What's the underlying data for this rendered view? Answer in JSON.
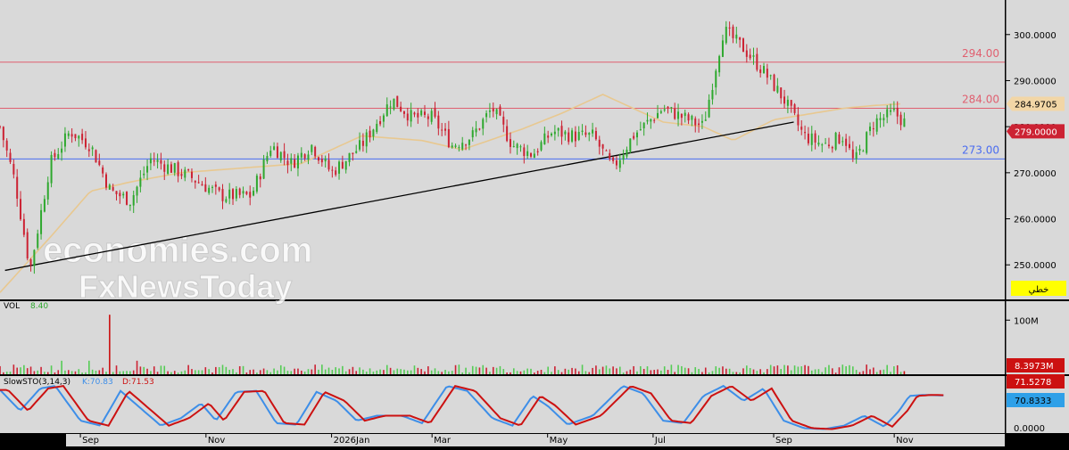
{
  "colors": {
    "background": "#d9d9d9",
    "frame": "#000000",
    "candle_up": "#2ea82e",
    "candle_down": "#cc2233",
    "resistance_line": "#e06070",
    "support_line": "#4a6cf0",
    "moving_average": "#e8c890",
    "trendline": "#000000",
    "stoch_k": "#3d8ee8",
    "stoch_d": "#cc1111",
    "volume": "#55cc55",
    "volume_last": "#cc1111"
  },
  "watermark": {
    "line1": "economies.com",
    "line2": "FxNewsToday"
  },
  "controls": {
    "line_tool_label": "خطي"
  },
  "chart_data": [
    {
      "type": "candlestick",
      "x_axis": {
        "tick_labels": [
          "Sep",
          "Nov",
          "2026Jan",
          "Mar",
          "May",
          "Jul",
          "Sep",
          "Nov"
        ]
      },
      "y_axis": {
        "min": 242.5,
        "max": 307.5,
        "tick_labels": [
          "250.0000",
          "260.0000",
          "270.0000",
          "280.0000",
          "290.0000",
          "300.0000"
        ],
        "ticks": [
          250,
          260,
          270,
          280,
          290,
          300
        ]
      },
      "horizontal_levels": [
        {
          "value": 294.0,
          "label": "294.00",
          "color": "resistance"
        },
        {
          "value": 284.0,
          "label": "284.00",
          "color": "resistance"
        },
        {
          "value": 273.0,
          "label": "273.00",
          "color": "support"
        }
      ],
      "price_tags": [
        {
          "label": "284.9705",
          "value": 284.97,
          "kind": "moving_average"
        },
        {
          "label": "279.0000",
          "value": 279.0,
          "kind": "last_price"
        }
      ],
      "trendline": {
        "from": {
          "x": 0.005,
          "y": 248.8
        },
        "to": {
          "x": 0.79,
          "y": 281.0
        }
      },
      "moving_average_anchors": [
        [
          0.0,
          244
        ],
        [
          0.05,
          256
        ],
        [
          0.09,
          266
        ],
        [
          0.13,
          268
        ],
        [
          0.18,
          270
        ],
        [
          0.24,
          271
        ],
        [
          0.3,
          272
        ],
        [
          0.36,
          278
        ],
        [
          0.42,
          277
        ],
        [
          0.46,
          275
        ],
        [
          0.5,
          278
        ],
        [
          0.52,
          279.5
        ],
        [
          0.56,
          283
        ],
        [
          0.6,
          287
        ],
        [
          0.62,
          285
        ],
        [
          0.66,
          281
        ],
        [
          0.7,
          280
        ],
        [
          0.73,
          277
        ],
        [
          0.77,
          281.5
        ],
        [
          0.84,
          284.0
        ],
        [
          0.87,
          284.6
        ],
        [
          0.9,
          285.0
        ]
      ],
      "price_anchors": [
        [
          0.0,
          280
        ],
        [
          0.015,
          268
        ],
        [
          0.03,
          249
        ],
        [
          0.05,
          272
        ],
        [
          0.07,
          279
        ],
        [
          0.09,
          276
        ],
        [
          0.11,
          266
        ],
        [
          0.13,
          264
        ],
        [
          0.15,
          273
        ],
        [
          0.17,
          271
        ],
        [
          0.19,
          269
        ],
        [
          0.22,
          265
        ],
        [
          0.25,
          265
        ],
        [
          0.27,
          276
        ],
        [
          0.29,
          272
        ],
        [
          0.31,
          276
        ],
        [
          0.33,
          270
        ],
        [
          0.36,
          276
        ],
        [
          0.39,
          286
        ],
        [
          0.41,
          282
        ],
        [
          0.43,
          282
        ],
        [
          0.45,
          276
        ],
        [
          0.47,
          278
        ],
        [
          0.49,
          284
        ],
        [
          0.51,
          276
        ],
        [
          0.53,
          274
        ],
        [
          0.55,
          279
        ],
        [
          0.57,
          278
        ],
        [
          0.59,
          278
        ],
        [
          0.61,
          271
        ],
        [
          0.63,
          278
        ],
        [
          0.66,
          284
        ],
        [
          0.68,
          282
        ],
        [
          0.7,
          280
        ],
        [
          0.72,
          301
        ],
        [
          0.74,
          297
        ],
        [
          0.76,
          292
        ],
        [
          0.78,
          286
        ],
        [
          0.8,
          278
        ],
        [
          0.82,
          276
        ],
        [
          0.84,
          278
        ],
        [
          0.85,
          272
        ],
        [
          0.87,
          281
        ],
        [
          0.89,
          283
        ],
        [
          0.9,
          281
        ]
      ],
      "candle_count": 265
    },
    {
      "type": "bar",
      "name": "VOL",
      "value_label": "8.40",
      "y_axis": {
        "tick_labels": [
          "100M"
        ],
        "max": 135
      },
      "tags": [
        {
          "label": "8.3973M"
        }
      ],
      "spike_value": 110,
      "typical_range": [
        3,
        18
      ]
    },
    {
      "type": "line",
      "name": "SlowSTO(3,14,3)",
      "series": [
        {
          "name": "K",
          "label": "K:70.83",
          "value": 70.83
        },
        {
          "name": "D",
          "label": "D:71.53",
          "value": 71.53
        }
      ],
      "y_axis": {
        "tick_labels": [
          "0.0000"
        ],
        "min": -5,
        "max": 110
      },
      "tags": [
        {
          "label": "71.5278"
        },
        {
          "label": "70.8333"
        }
      ],
      "k_anchors": [
        [
          0.0,
          82
        ],
        [
          0.02,
          40
        ],
        [
          0.04,
          85
        ],
        [
          0.055,
          90
        ],
        [
          0.08,
          20
        ],
        [
          0.1,
          10
        ],
        [
          0.12,
          80
        ],
        [
          0.14,
          45
        ],
        [
          0.16,
          10
        ],
        [
          0.18,
          25
        ],
        [
          0.2,
          55
        ],
        [
          0.215,
          20
        ],
        [
          0.235,
          78
        ],
        [
          0.255,
          80
        ],
        [
          0.275,
          15
        ],
        [
          0.295,
          12
        ],
        [
          0.315,
          78
        ],
        [
          0.335,
          60
        ],
        [
          0.355,
          20
        ],
        [
          0.375,
          30
        ],
        [
          0.4,
          30
        ],
        [
          0.42,
          15
        ],
        [
          0.445,
          90
        ],
        [
          0.465,
          80
        ],
        [
          0.49,
          25
        ],
        [
          0.51,
          10
        ],
        [
          0.53,
          70
        ],
        [
          0.545,
          50
        ],
        [
          0.565,
          12
        ],
        [
          0.59,
          30
        ],
        [
          0.62,
          90
        ],
        [
          0.64,
          75
        ],
        [
          0.66,
          20
        ],
        [
          0.68,
          15
        ],
        [
          0.7,
          70
        ],
        [
          0.72,
          90
        ],
        [
          0.74,
          60
        ],
        [
          0.76,
          85
        ],
        [
          0.78,
          20
        ],
        [
          0.8,
          5
        ],
        [
          0.82,
          3
        ],
        [
          0.84,
          10
        ],
        [
          0.86,
          30
        ],
        [
          0.88,
          8
        ],
        [
          0.895,
          40
        ],
        [
          0.905,
          70
        ],
        [
          0.92,
          72
        ],
        [
          0.94,
          70.83
        ]
      ]
    }
  ]
}
